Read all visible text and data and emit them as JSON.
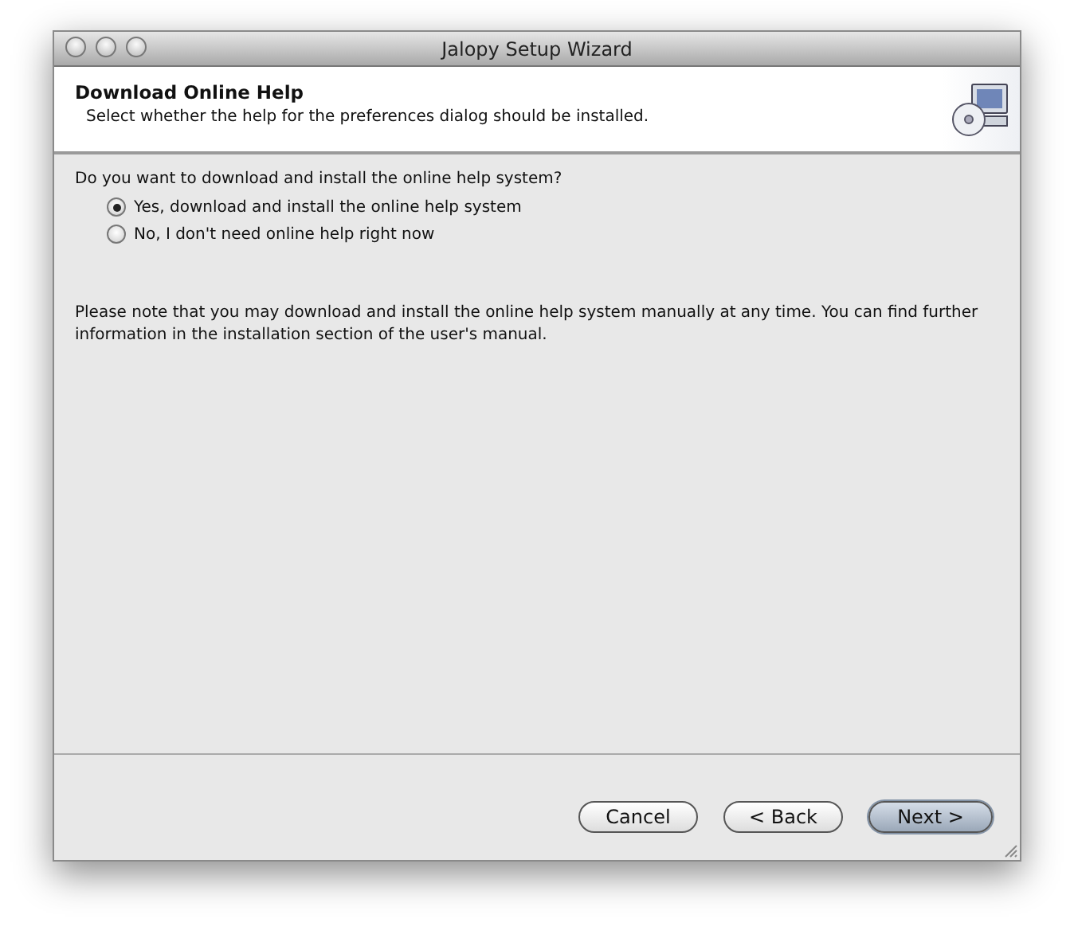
{
  "window": {
    "title": "Jalopy Setup Wizard"
  },
  "header": {
    "title": "Download Online Help",
    "subtitle": "Select whether the help for the preferences dialog should be installed."
  },
  "question": "Do you want to download and install the online help system?",
  "options": [
    {
      "label": "Yes, download and install the online help system",
      "selected": true
    },
    {
      "label": "No, I don't need online help right now",
      "selected": false
    }
  ],
  "note": "Please note that you may download and install the online help system manually at any time. You can find further information in the installation section of the user's manual.",
  "buttons": [
    {
      "label": "Cancel",
      "default": false
    },
    {
      "label": "< Back",
      "default": false
    },
    {
      "label": "Next >",
      "default": true
    }
  ]
}
